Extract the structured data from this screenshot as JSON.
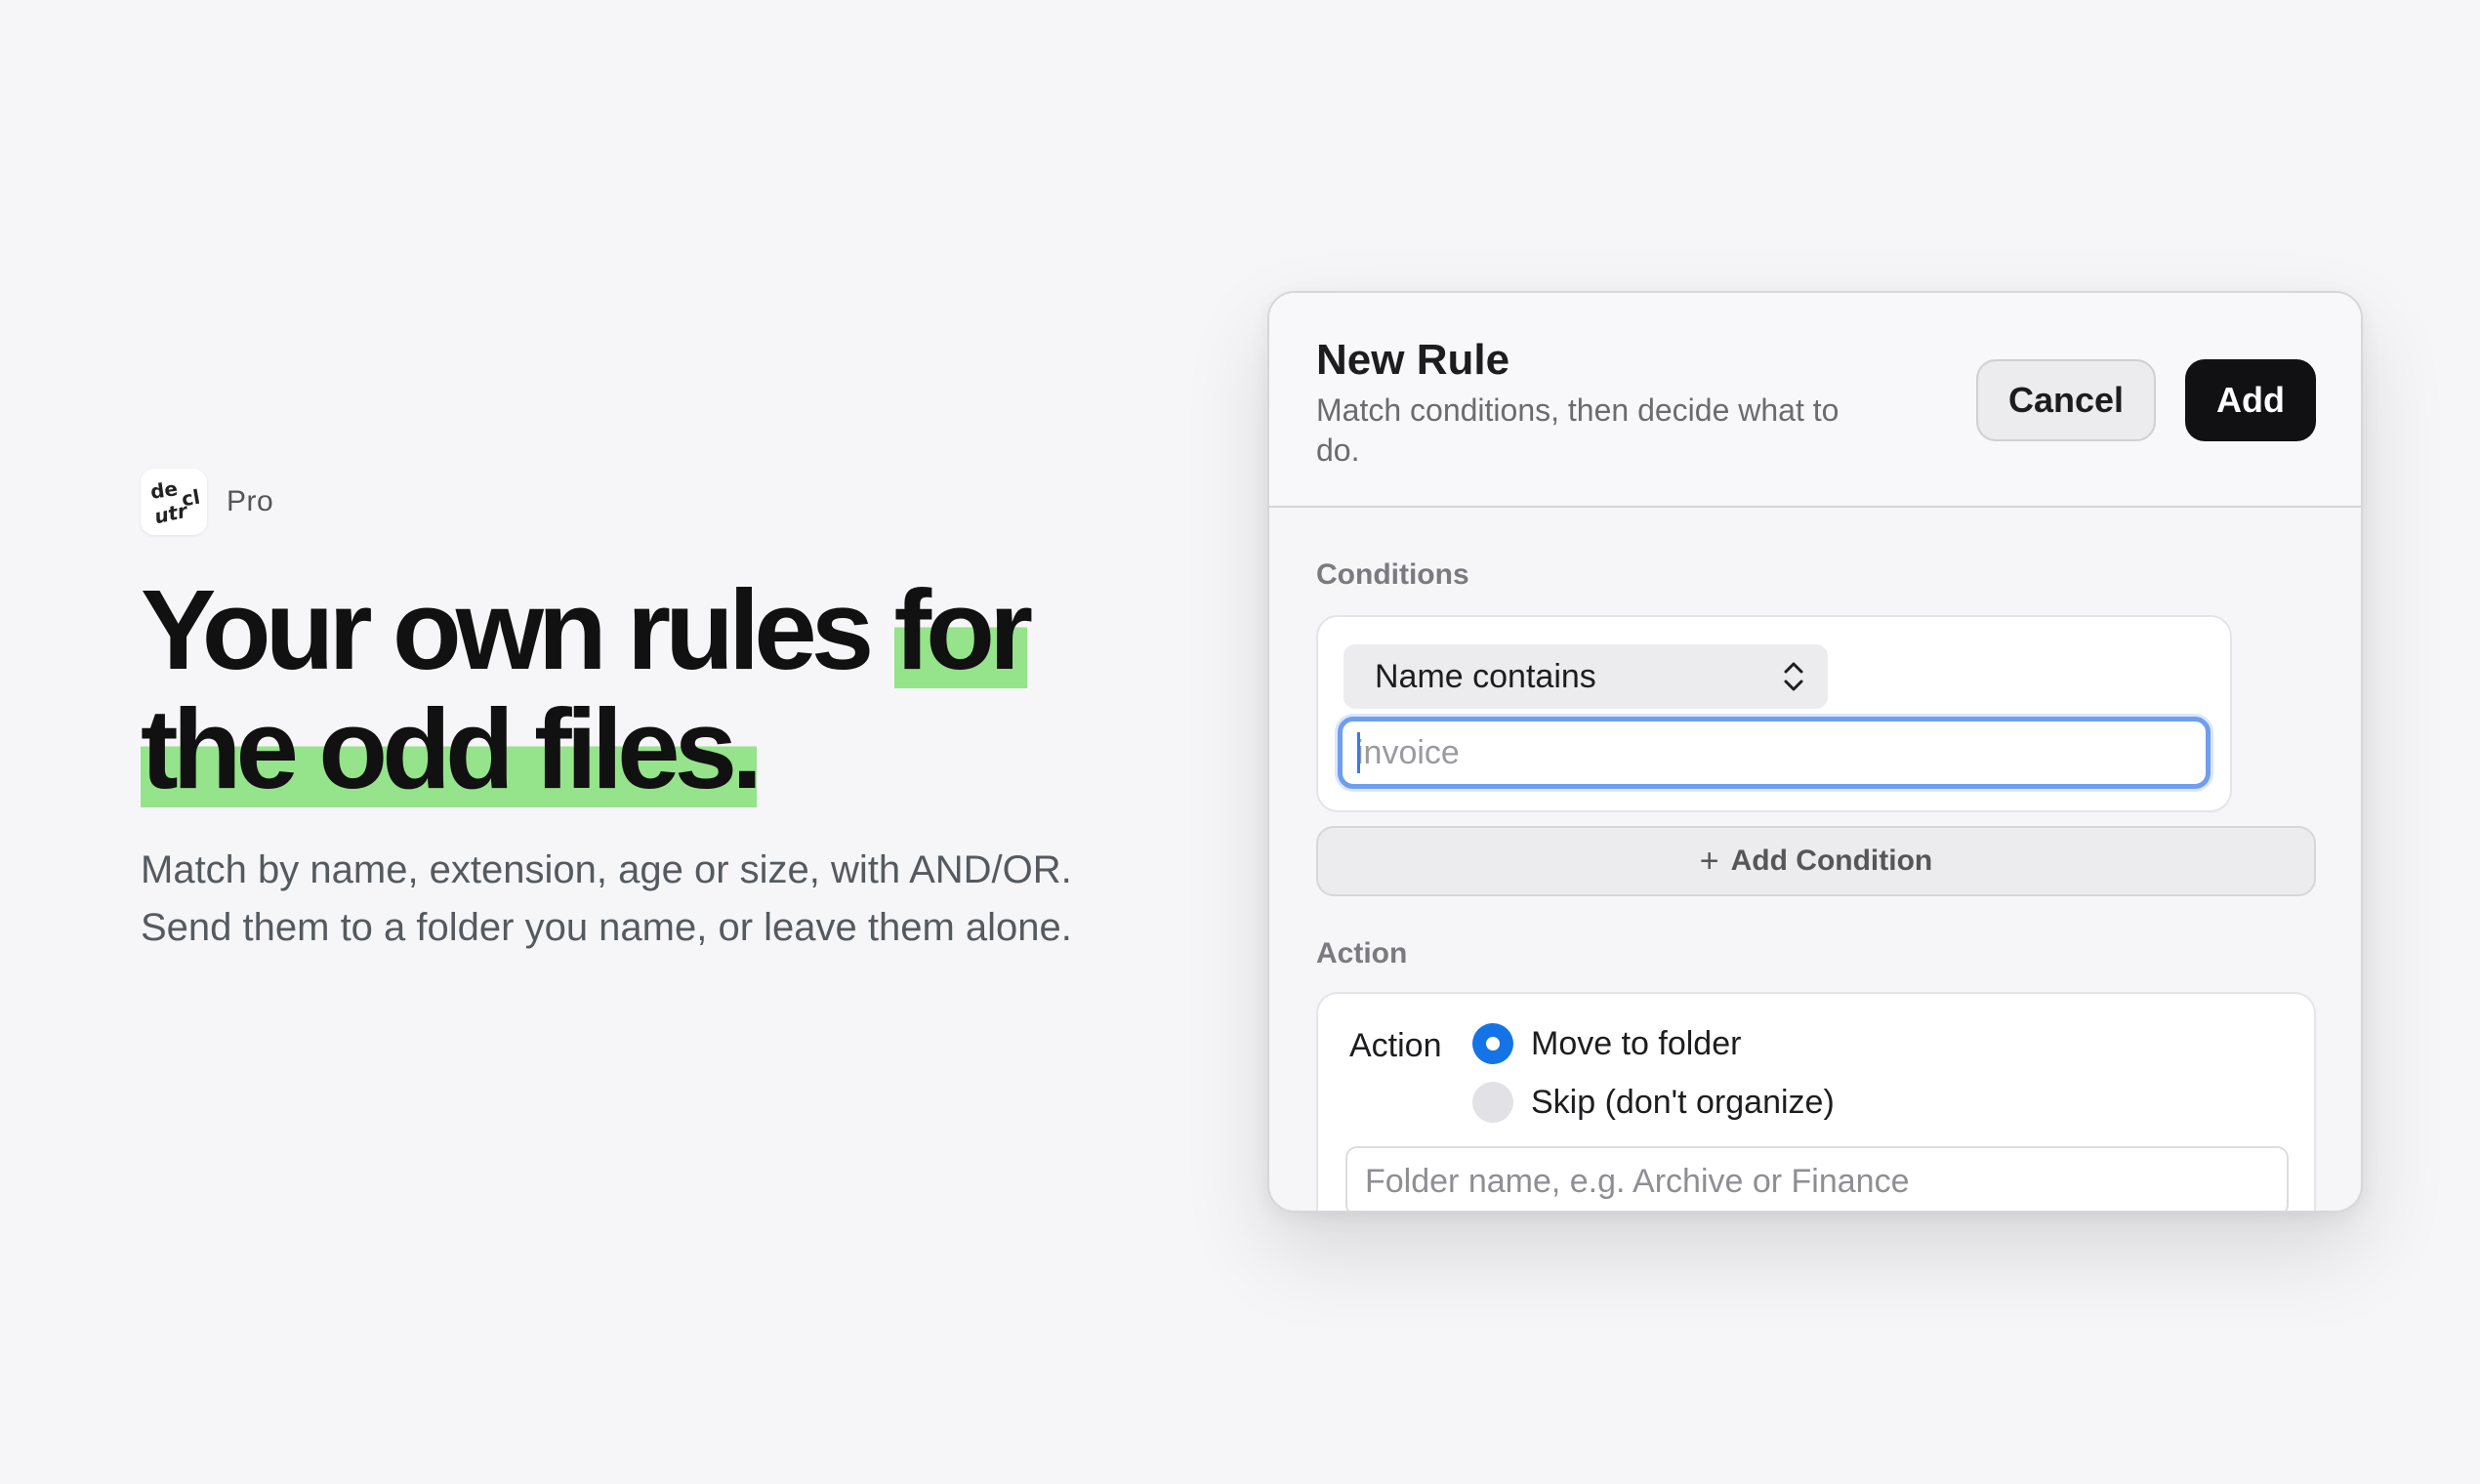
{
  "brand": {
    "logo_letters": [
      "de",
      "cl",
      "utr"
    ],
    "label": "Pro"
  },
  "hero": {
    "headline_part1": "Your own rules ",
    "headline_hl1": "for",
    "headline_hl2": "the odd files.",
    "subtext": "Match by name, extension, age or size, with AND/OR. Send them to a folder you name, or leave them alone.",
    "highlight_color": "#95e38a"
  },
  "dialog": {
    "title": "New Rule",
    "subtitle": "Match conditions, then decide what to do.",
    "cancel_label": "Cancel",
    "add_label": "Add",
    "conditions_label": "Conditions",
    "condition": {
      "selected": "Name contains",
      "value": "",
      "placeholder": "invoice"
    },
    "add_condition_label": "Add Condition",
    "action_section_label": "Action",
    "action": {
      "label": "Action",
      "options": [
        {
          "label": "Move to folder",
          "selected": true
        },
        {
          "label": "Skip (don't organize)",
          "selected": false
        }
      ],
      "folder_placeholder": "Folder name, e.g. Archive or Finance"
    },
    "accent_color": "#1473e6"
  }
}
